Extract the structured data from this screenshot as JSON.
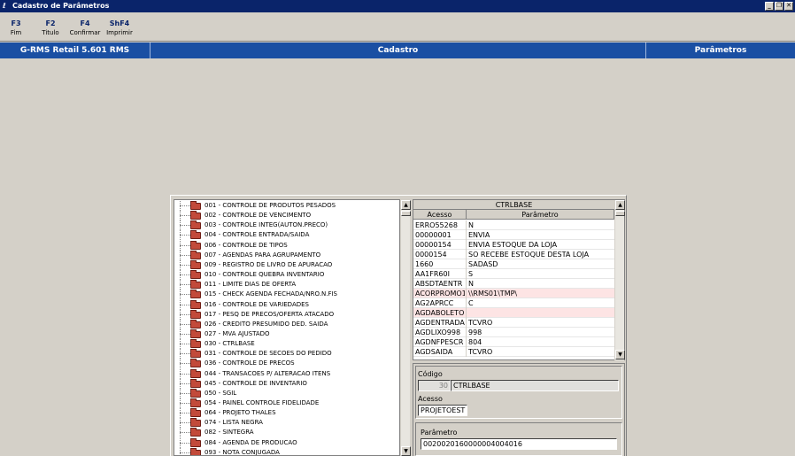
{
  "window": {
    "title": "Cadastro de Parâmetros",
    "icon": "app-icon",
    "buttons": [
      "minimize",
      "restore",
      "close"
    ]
  },
  "toolbar": [
    {
      "key": "F3",
      "label": "Fim"
    },
    {
      "key": "F2",
      "label": "Titulo"
    },
    {
      "key": "F4",
      "label": "Confirmar"
    },
    {
      "key": "ShF4",
      "label": "Imprimir"
    }
  ],
  "status": {
    "system": "G-RMS Retail 5.601 RMS",
    "module": "Cadastro",
    "screen": "Parâmetros"
  },
  "tree": {
    "items": [
      "001 - CONTROLE DE PRODUTOS PESADOS",
      "002 - CONTROLE DE VENCIMENTO",
      "003 - CONTROLE INTEG(AUTON.PRECO)",
      "004 - CONTROLE ENTRADA/SAIDA",
      "006 - CONTROLE DE TIPOS",
      "007 - AGENDAS PARA AGRUPAMENTO",
      "009 - REGISTRO DE LIVRO DE APURACAO",
      "010 - CONTROLE QUEBRA INVENTARIO",
      "011 - LIMITE DIAS DE OFERTA",
      "015 - CHECK AGENDA FECHADA/NRO.N.FIS",
      "016 - CONTROLE DE VARIEDADES",
      "017 - PESQ DE PRECOS/OFERTA ATACADO",
      "026 - CREDITO PRESUMIDO DED. SAIDA",
      "027 - MVA AJUSTADO",
      "030 - CTRLBASE",
      "031 - CONTROLE DE SECOES DO PEDIDO",
      "036 - CONTROLE DE PRECOS",
      "044 - TRANSACOES P/ ALTERACAO ITENS",
      "045 - CONTROLE DE INVENTARIO",
      "050 - SGIL",
      "054 - PAINEL CONTROLE FIDELIDADE",
      "064 - PROJETO THALES",
      "074 - LISTA NEGRA",
      "082 - SINTEGRA",
      "084 - AGENDA DE PRODUCAO",
      "093 - NOTA CONJUGADA"
    ]
  },
  "grid": {
    "title": "CTRLBASE",
    "headers": [
      "Acesso",
      "Parâmetro"
    ],
    "rows": [
      {
        "acesso": "ERRO55268",
        "parametro": "N",
        "highlight": false
      },
      {
        "acesso": "00000001",
        "parametro": "ENVIA",
        "highlight": false
      },
      {
        "acesso": "00000154",
        "parametro": "ENVIA ESTOQUE DA LOJA",
        "highlight": false
      },
      {
        "acesso": "0000154",
        "parametro": "SO RECEBE ESTOQUE DESTA LOJA",
        "highlight": false
      },
      {
        "acesso": "1660",
        "parametro": "SADASD",
        "highlight": false
      },
      {
        "acesso": "AA1FR60I",
        "parametro": "S",
        "highlight": false
      },
      {
        "acesso": "ABSDTAENTR",
        "parametro": "N",
        "highlight": false
      },
      {
        "acesso": "ACORPROMO1",
        "parametro": "\\\\RMS01\\TMP\\",
        "highlight": true
      },
      {
        "acesso": "AG2APRCC",
        "parametro": "C",
        "highlight": false
      },
      {
        "acesso": "AGDABOLETO",
        "parametro": "",
        "highlight": true
      },
      {
        "acesso": "AGDENTRADA",
        "parametro": "TCVRO",
        "highlight": false
      },
      {
        "acesso": "AGDLIXO998",
        "parametro": "998",
        "highlight": false
      },
      {
        "acesso": "AGDNFPESCR",
        "parametro": "804",
        "highlight": false
      },
      {
        "acesso": "AGDSAIDA",
        "parametro": "TCVRO",
        "highlight": false
      }
    ]
  },
  "form": {
    "codigo_label": "Código",
    "codigo_num": "30",
    "codigo_name": "CTRLBASE",
    "acesso_label": "Acesso",
    "acesso_value": "PROJETOEST",
    "parametro_label": "Parâmetro",
    "parametro_value": "0020020160000004004016"
  }
}
